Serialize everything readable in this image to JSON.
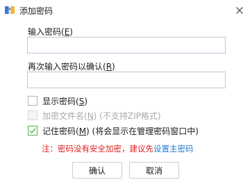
{
  "window": {
    "title": "添加密码",
    "icon": "archive-icon",
    "close_icon": "close-icon"
  },
  "fields": {
    "password_label": "输入密码(",
    "password_key": "E",
    "password_label_end": ")",
    "password_value": "",
    "confirm_label": "再次输入密码以确认(",
    "confirm_key": "R",
    "confirm_label_end": ")",
    "confirm_value": ""
  },
  "options": {
    "show_password": {
      "label": "显示密码(",
      "key": "S",
      "end": ")",
      "checked": false,
      "enabled": true
    },
    "encrypt_filenames": {
      "label": "加密文件名(",
      "key": "N",
      "end": ") (不支持ZIP格式)",
      "checked": false,
      "enabled": false
    },
    "remember_password": {
      "label": "记住密码(",
      "key": "M",
      "end": ") (将会显示在管理密码窗口中)",
      "checked": true,
      "enabled": true
    }
  },
  "note": {
    "text": "注：密码没有安全加密，建议先",
    "link": "设置主密码"
  },
  "buttons": {
    "ok": "确认",
    "cancel": "取消"
  },
  "colors": {
    "warning": "#e02020",
    "link": "#2a7bd3",
    "checkbox_check": "#4caf50",
    "input_border": "#b9c7d8"
  }
}
